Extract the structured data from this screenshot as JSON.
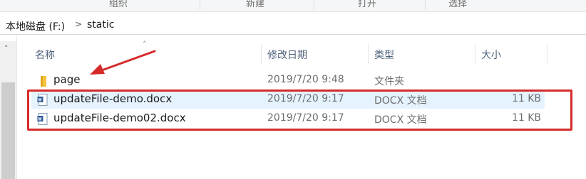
{
  "ribbon": {
    "groups": [
      "组织",
      "新建",
      "打开",
      "选择"
    ]
  },
  "address": {
    "drive": "本地磁盘 (F:)",
    "folder": "static",
    "separator": ">"
  },
  "columns": {
    "name": "名称",
    "modified": "修改日期",
    "type": "类型",
    "size": "大小"
  },
  "files": [
    {
      "name": "page",
      "modified": "2019/7/20 9:48",
      "type": "文件夹",
      "size": "",
      "icon": "folder-icon"
    },
    {
      "name": "updateFile-demo.docx",
      "modified": "2019/7/20 9:17",
      "type": "DOCX 文档",
      "size": "11 KB",
      "icon": "docx-file-icon"
    },
    {
      "name": "updateFile-demo02.docx",
      "modified": "2019/7/20 9:17",
      "type": "DOCX 文档",
      "size": "11 KB",
      "icon": "docx-file-icon"
    }
  ],
  "colors": {
    "annotation": "#d62a2a",
    "selection": "#e5f3ff",
    "folder": "#f4c23c",
    "docx": "#2b579a"
  }
}
